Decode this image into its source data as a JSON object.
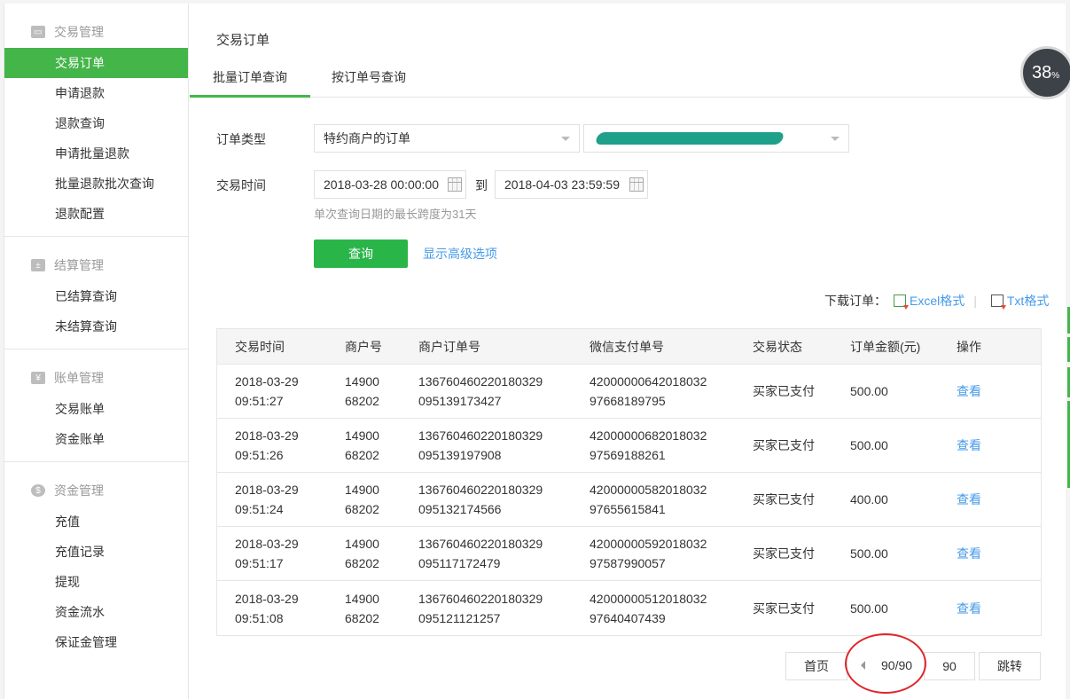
{
  "sidebar": {
    "groups": [
      {
        "title": "交易管理",
        "icon": "card-icon",
        "items": [
          "交易订单",
          "申请退款",
          "退款查询",
          "申请批量退款",
          "批量退款批次查询",
          "退款配置"
        ]
      },
      {
        "title": "结算管理",
        "icon": "calculator-icon",
        "items": [
          "已结算查询",
          "未结算查询"
        ]
      },
      {
        "title": "账单管理",
        "icon": "yen-icon",
        "items": [
          "交易账单",
          "资金账单"
        ]
      },
      {
        "title": "资金管理",
        "icon": "money-bag-icon",
        "items": [
          "充值",
          "充值记录",
          "提现",
          "资金流水",
          "保证金管理"
        ]
      }
    ]
  },
  "main": {
    "title": "交易订单",
    "tabs": [
      "批量订单查询",
      "按订单号查询"
    ],
    "form": {
      "order_type_label": "订单类型",
      "order_type_value": "特约商户的订单",
      "trade_time_label": "交易时间",
      "start_time": "2018-03-28 00:00:00",
      "to_label": "到",
      "end_time": "2018-04-03 23:59:59",
      "hint": "单次查询日期的最长跨度为31天",
      "query_button": "查询",
      "advanced_link": "显示高级选项"
    },
    "download": {
      "label": "下载订单：",
      "excel": "Excel格式",
      "sep": "|",
      "txt": "Txt格式"
    },
    "table": {
      "headers": [
        "交易时间",
        "商户号",
        "商户订单号",
        "微信支付单号",
        "交易状态",
        "订单金额(元)",
        "操作"
      ],
      "rows": [
        {
          "date": "2018-03-29",
          "time": "09:51:27",
          "mch1": "14900",
          "mch2": "68202",
          "ord1": "136760460220180329",
          "ord2": "095139173427",
          "wx1": "42000000642018032",
          "wx2": "97668189795",
          "status": "买家已支付",
          "amount": "500.00",
          "action": "查看"
        },
        {
          "date": "2018-03-29",
          "time": "09:51:26",
          "mch1": "14900",
          "mch2": "68202",
          "ord1": "136760460220180329",
          "ord2": "095139197908",
          "wx1": "42000000682018032",
          "wx2": "97569188261",
          "status": "买家已支付",
          "amount": "500.00",
          "action": "查看"
        },
        {
          "date": "2018-03-29",
          "time": "09:51:24",
          "mch1": "14900",
          "mch2": "68202",
          "ord1": "136760460220180329",
          "ord2": "095132174566",
          "wx1": "42000000582018032",
          "wx2": "97655615841",
          "status": "买家已支付",
          "amount": "400.00",
          "action": "查看"
        },
        {
          "date": "2018-03-29",
          "time": "09:51:17",
          "mch1": "14900",
          "mch2": "68202",
          "ord1": "136760460220180329",
          "ord2": "095117172479",
          "wx1": "42000000592018032",
          "wx2": "97587990057",
          "status": "买家已支付",
          "amount": "500.00",
          "action": "查看"
        },
        {
          "date": "2018-03-29",
          "time": "09:51:08",
          "mch1": "14900",
          "mch2": "68202",
          "ord1": "136760460220180329",
          "ord2": "095121121257",
          "wx1": "42000000512018032",
          "wx2": "97640407439",
          "status": "买家已支付",
          "amount": "500.00",
          "action": "查看"
        }
      ]
    },
    "pager": {
      "first": "首页",
      "count": "90/90",
      "jump_value": "90",
      "jump": "跳转"
    }
  },
  "progress": {
    "value": "38",
    "unit": "%"
  },
  "colors": {
    "accent": "#44b549",
    "link": "#459ae9",
    "annotation": "#e0262b"
  }
}
